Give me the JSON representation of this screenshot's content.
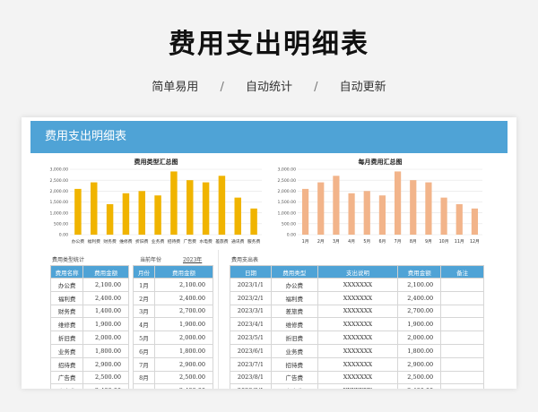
{
  "hero": {
    "title": "费用支出明细表",
    "features": [
      "简单易用",
      "自动统计",
      "自动更新"
    ],
    "separator": "/"
  },
  "sheet": {
    "header": "费用支出明细表",
    "colors": {
      "header": "#4fa3d6",
      "bar_gold": "#f0b400",
      "bar_peach": "#f2b48a"
    }
  },
  "chart_data": [
    {
      "type": "bar",
      "title": "费用类型汇总图",
      "categories": [
        "办公费",
        "福利费",
        "财务费",
        "维修费",
        "折旧费",
        "业务费",
        "招待费",
        "广告费",
        "水电费",
        "差旅费",
        "通讯费",
        "服务费"
      ],
      "values": [
        2100,
        2400,
        1400,
        1900,
        2000,
        1800,
        2900,
        2500,
        2400,
        2700,
        1700,
        1200
      ],
      "ylim": [
        0,
        3000
      ],
      "yticks": [
        "3,000.00",
        "2,500.00",
        "2,000.00",
        "1,500.00",
        "1,000.00",
        "500.00",
        "0.00"
      ],
      "color": "#f0b400"
    },
    {
      "type": "bar",
      "title": "每月费用汇总图",
      "categories": [
        "1月",
        "2月",
        "3月",
        "4月",
        "5月",
        "6月",
        "7月",
        "8月",
        "9月",
        "10月",
        "11月",
        "12月"
      ],
      "values": [
        2100,
        2400,
        2700,
        1900,
        2000,
        1800,
        2900,
        2500,
        2400,
        1700,
        1400,
        1200
      ],
      "ylim": [
        0,
        3000
      ],
      "yticks": [
        "3,000.00",
        "2,500.00",
        "2,000.00",
        "1,500.00",
        "1,000.00",
        "500.00",
        "0.00"
      ],
      "color": "#f2b48a"
    }
  ],
  "stats": {
    "label": "费用类型统计",
    "year_label": "当前年份",
    "year_value": "2023年",
    "type_table": {
      "headers": [
        "费用名称",
        "费用金额"
      ],
      "rows": [
        [
          "办公费",
          "2,100.00"
        ],
        [
          "福利费",
          "2,400.00"
        ],
        [
          "财务费",
          "1,400.00"
        ],
        [
          "维修费",
          "1,900.00"
        ],
        [
          "折旧费",
          "2,000.00"
        ],
        [
          "业务费",
          "1,800.00"
        ],
        [
          "招待费",
          "2,900.00"
        ],
        [
          "广告费",
          "2,500.00"
        ],
        [
          "水电费",
          "2,400.00"
        ]
      ]
    },
    "month_table": {
      "headers": [
        "月份",
        "费用金额"
      ],
      "rows": [
        [
          "1月",
          "2,100.00"
        ],
        [
          "2月",
          "2,400.00"
        ],
        [
          "3月",
          "2,700.00"
        ],
        [
          "4月",
          "1,900.00"
        ],
        [
          "5月",
          "2,000.00"
        ],
        [
          "6月",
          "1,800.00"
        ],
        [
          "7月",
          "2,900.00"
        ],
        [
          "8月",
          "2,500.00"
        ],
        [
          "9月",
          "2,400.00"
        ]
      ]
    }
  },
  "expense": {
    "label": "费用支出表",
    "headers": [
      "日期",
      "费用类型",
      "支出说明",
      "费用金额",
      "备注"
    ],
    "rows": [
      [
        "2023/1/1",
        "办公费",
        "XXXXXXX",
        "2,100.00",
        ""
      ],
      [
        "2023/2/1",
        "福利费",
        "XXXXXXX",
        "2,400.00",
        ""
      ],
      [
        "2023/3/1",
        "差旅费",
        "XXXXXXX",
        "2,700.00",
        ""
      ],
      [
        "2023/4/1",
        "维修费",
        "XXXXXXX",
        "1,900.00",
        ""
      ],
      [
        "2023/5/1",
        "折旧费",
        "XXXXXXX",
        "2,000.00",
        ""
      ],
      [
        "2023/6/1",
        "业务费",
        "XXXXXXX",
        "1,800.00",
        ""
      ],
      [
        "2023/7/1",
        "招待费",
        "XXXXXXX",
        "2,900.00",
        ""
      ],
      [
        "2023/8/1",
        "广告费",
        "XXXXXXX",
        "2,500.00",
        ""
      ],
      [
        "2023/9/1",
        "水电费",
        "XXXXXXX",
        "2,400.00",
        ""
      ]
    ]
  }
}
